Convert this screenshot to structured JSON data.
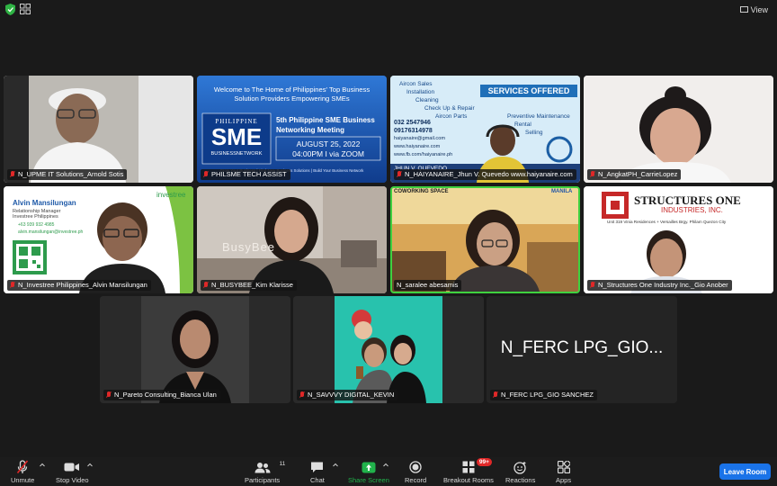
{
  "topbar": {
    "view_label": "View"
  },
  "participants": [
    {
      "name": "N_UPME IT Solutions_Arnold Sotis"
    },
    {
      "name": "PHILSME TECH ASSIST"
    },
    {
      "name": "N_HAIYANAIRE_Jhun V. Quevedo www.haiyanaire.com"
    },
    {
      "name": "N_AngkatPH_CarrieLopez"
    },
    {
      "name": "N_Investree Philippines_Alvin Mansilungan"
    },
    {
      "name": "N_BUSYBEE_Kim Klarisse"
    },
    {
      "name": "N_saralee abesamis"
    },
    {
      "name": "N_Structures One Industry Inc._Gio Anober"
    },
    {
      "name": "N_Pareto Consulting_Bianca Ulan"
    },
    {
      "name": "N_SAVVVY DIGITAL_KEVIN"
    },
    {
      "name": "N_FERC LPG_GIO SANCHEZ"
    }
  ],
  "sme_banner": {
    "welcome": "Welcome to The Home of Philippines' Top Business Solution Providers Empowering SMEs",
    "logo_top": "PHILIPPINE",
    "logo_main": "SME",
    "logo_sub": "BUSINESSNETWORK",
    "event": "5th Philippine SME Business Networking Meeting",
    "date": "AUGUST 25, 2022",
    "time": "04:00PM I via ZOOM",
    "footer": "Grow Your Business | Find New Business Solutions | Build Your Business Network"
  },
  "haiyan_banner": {
    "title": "SERVICES OFFERED",
    "services": [
      "Aircon Sales",
      "Installation",
      "Cleaning",
      "Check Up & Repair",
      "Aircon Parts",
      "Preventive Maintenance",
      "Rental",
      "Selling"
    ],
    "phone1": "032 2547946",
    "phone2": "09176314978",
    "email": "haiyanaire@gmail.com",
    "web": "www.haiyanaire.com",
    "fb": "www.fb.com/haiyanaire.ph",
    "person": "JHUN V. QUEVEDO"
  },
  "investree_card": {
    "name": "Alvin Mansilungan",
    "role": "Relationship Manager",
    "company": "Investree Philippines",
    "phone": "+63 939 932 4985",
    "email": "alvin.mansilungan@investree.ph",
    "brand": "investree"
  },
  "busybee_sign": "BusyBee",
  "coworking": {
    "label": "COWORKING SPACE",
    "brand": "MANILA"
  },
  "structures": {
    "title": "STRUCTURES ONE",
    "subtitle": "INDUSTRIES, INC.",
    "address": "Unit 319 Vinia Residences + Versailles Brgy. Philam Quezon City"
  },
  "ferc_display": "N_FERC LPG_GIO...",
  "toolbar": {
    "unmute": "Unmute",
    "stop_video": "Stop Video",
    "participants": "Participants",
    "participants_count": "11",
    "chat": "Chat",
    "share_screen": "Share Screen",
    "record": "Record",
    "breakout_rooms": "Breakout Rooms",
    "breakout_badge": "99+",
    "reactions": "Reactions",
    "apps": "Apps",
    "leave": "Leave Room"
  },
  "colors": {
    "accent_blue": "#1a73e8",
    "share_green": "#21b24b",
    "mute_red": "#e02828",
    "active_speaker": "#3fd13f"
  }
}
